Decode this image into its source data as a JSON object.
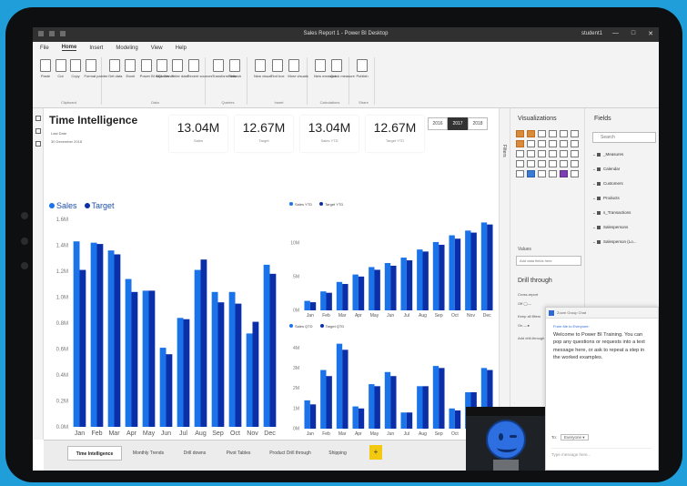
{
  "window": {
    "title": "Sales Report 1 - Power BI Desktop",
    "user": "student1",
    "controls": [
      "—",
      "□",
      "✕"
    ]
  },
  "menu": [
    {
      "label": "File",
      "active": false
    },
    {
      "label": "Home",
      "active": true
    },
    {
      "label": "Insert",
      "active": false
    },
    {
      "label": "Modeling",
      "active": false
    },
    {
      "label": "View",
      "active": false
    },
    {
      "label": "Help",
      "active": false
    }
  ],
  "ribbon": {
    "groups": [
      {
        "label": "Clipboard",
        "buttons": [
          "Paste",
          "Cut",
          "Copy",
          "Format painter"
        ]
      },
      {
        "label": "Data",
        "buttons": [
          "Get data",
          "Excel",
          "Power BI datasets",
          "SQL Server",
          "Enter data",
          "Recent sources"
        ]
      },
      {
        "label": "Queries",
        "buttons": [
          "Transform data",
          "Refresh"
        ]
      },
      {
        "label": "Insert",
        "buttons": [
          "New visual",
          "Text box",
          "More visuals"
        ]
      },
      {
        "label": "Calculations",
        "buttons": [
          "New measure",
          "Quick measure"
        ]
      },
      {
        "label": "Share",
        "buttons": [
          "Publish"
        ]
      }
    ]
  },
  "report": {
    "title": "Time Intelligence",
    "last_date_label": "Last Date",
    "last_date": "30 December 2018",
    "kpis": [
      {
        "value": "13.04M",
        "label": "Sales"
      },
      {
        "value": "12.67M",
        "label": "Target"
      },
      {
        "value": "13.04M",
        "label": "Sales YTD"
      },
      {
        "value": "12.67M",
        "label": "Target YTD"
      }
    ],
    "years": [
      {
        "label": "2016",
        "selected": false
      },
      {
        "label": "2017",
        "selected": true
      },
      {
        "label": "2018",
        "selected": false
      }
    ]
  },
  "colors": {
    "sales": "#1a73e8",
    "target": "#0b2fa8",
    "ytd_sales": "#1a73e8",
    "ytd_target": "#0b2fa8"
  },
  "chart_data": [
    {
      "type": "bar",
      "categories": [
        "Jan",
        "Feb",
        "Mar",
        "Apr",
        "May",
        "Jun",
        "Jul",
        "Aug",
        "Sep",
        "Oct",
        "Nov",
        "Dec"
      ],
      "series": [
        {
          "name": "Sales",
          "values": [
            1.43,
            1.42,
            1.36,
            1.14,
            1.05,
            0.61,
            0.84,
            1.21,
            1.04,
            1.04,
            0.72,
            1.25
          ]
        },
        {
          "name": "Target",
          "values": [
            1.21,
            1.41,
            1.33,
            1.04,
            1.05,
            0.56,
            0.83,
            1.29,
            0.96,
            0.95,
            0.81,
            1.18
          ]
        }
      ],
      "yticks": [
        "0.0M",
        "0.2M",
        "0.4M",
        "0.6M",
        "0.8M",
        "1.0M",
        "1.2M",
        "1.4M",
        "1.6M"
      ],
      "ylim": [
        0,
        1.6
      ],
      "legend": "top-left"
    },
    {
      "type": "bar",
      "categories": [
        "Jan",
        "Feb",
        "Mar",
        "Apr",
        "May",
        "Jun",
        "Jul",
        "Aug",
        "Sep",
        "Oct",
        "Nov",
        "Dec"
      ],
      "series": [
        {
          "name": "Sales YTD",
          "values": [
            1.4,
            2.8,
            4.2,
            5.3,
            6.4,
            7.0,
            7.8,
            9.0,
            10.1,
            11.1,
            11.8,
            13.0
          ]
        },
        {
          "name": "Target YTD",
          "values": [
            1.2,
            2.6,
            3.9,
            5.0,
            6.0,
            6.6,
            7.4,
            8.7,
            9.7,
            10.6,
            11.5,
            12.7
          ]
        }
      ],
      "yticks": [
        "0M",
        "5M",
        "10M"
      ],
      "ylim": [
        0,
        14
      ],
      "legend": "top-left"
    },
    {
      "type": "bar",
      "categories": [
        "Jan",
        "Feb",
        "Mar",
        "Apr",
        "May",
        "Jun",
        "Jul",
        "Aug",
        "Sep",
        "Oct",
        "Nov",
        "Dec"
      ],
      "series": [
        {
          "name": "Sales QTD",
          "values": [
            1.4,
            2.9,
            4.2,
            1.1,
            2.2,
            2.8,
            0.8,
            2.1,
            3.1,
            1.0,
            1.8,
            3.0
          ]
        },
        {
          "name": "Target QTD",
          "values": [
            1.2,
            2.6,
            3.9,
            1.0,
            2.1,
            2.6,
            0.8,
            2.1,
            3.0,
            0.9,
            1.8,
            2.9
          ]
        }
      ],
      "yticks": [
        "0M",
        "1M",
        "2M",
        "3M",
        "4M"
      ],
      "ylim": [
        0,
        4.5
      ],
      "legend": "top-left"
    }
  ],
  "page_tabs": [
    {
      "label": "Time Intelligence",
      "active": true
    },
    {
      "label": "Monthly Trends",
      "active": false
    },
    {
      "label": "Drill downs",
      "active": false
    },
    {
      "label": "Pivot Tables",
      "active": false
    },
    {
      "label": "Product Drill through",
      "active": false
    },
    {
      "label": "Shipping",
      "active": false
    }
  ],
  "add_page": "+",
  "filters_label": "Filters",
  "visualizations": {
    "title": "Visualizations",
    "values_label": "Values",
    "values_placeholder": "Add data fields here",
    "drill_title": "Drill through",
    "cross_report": "Cross-report",
    "cross_state": "Off",
    "keep_filters": "Keep all filters",
    "keep_state": "On",
    "add_drill": "Add drill-through fields here"
  },
  "fields": {
    "title": "Fields",
    "search_placeholder": "Search",
    "tables": [
      "_Measures",
      "Calendar",
      "Customers",
      "Products",
      "s_Transactions",
      "Salespersons",
      "Salesperson (Lo..."
    ]
  },
  "chat": {
    "header": "Zoom Group Chat",
    "from": "From Me to Everyone:",
    "message": "Welcome to Power BI Training. You can pop any questions or requests into a text message here, or ask to repeat a step in the worked examples.",
    "to_label": "To:",
    "to_value": "Everyone ▾",
    "input_placeholder": "Type message here..."
  }
}
